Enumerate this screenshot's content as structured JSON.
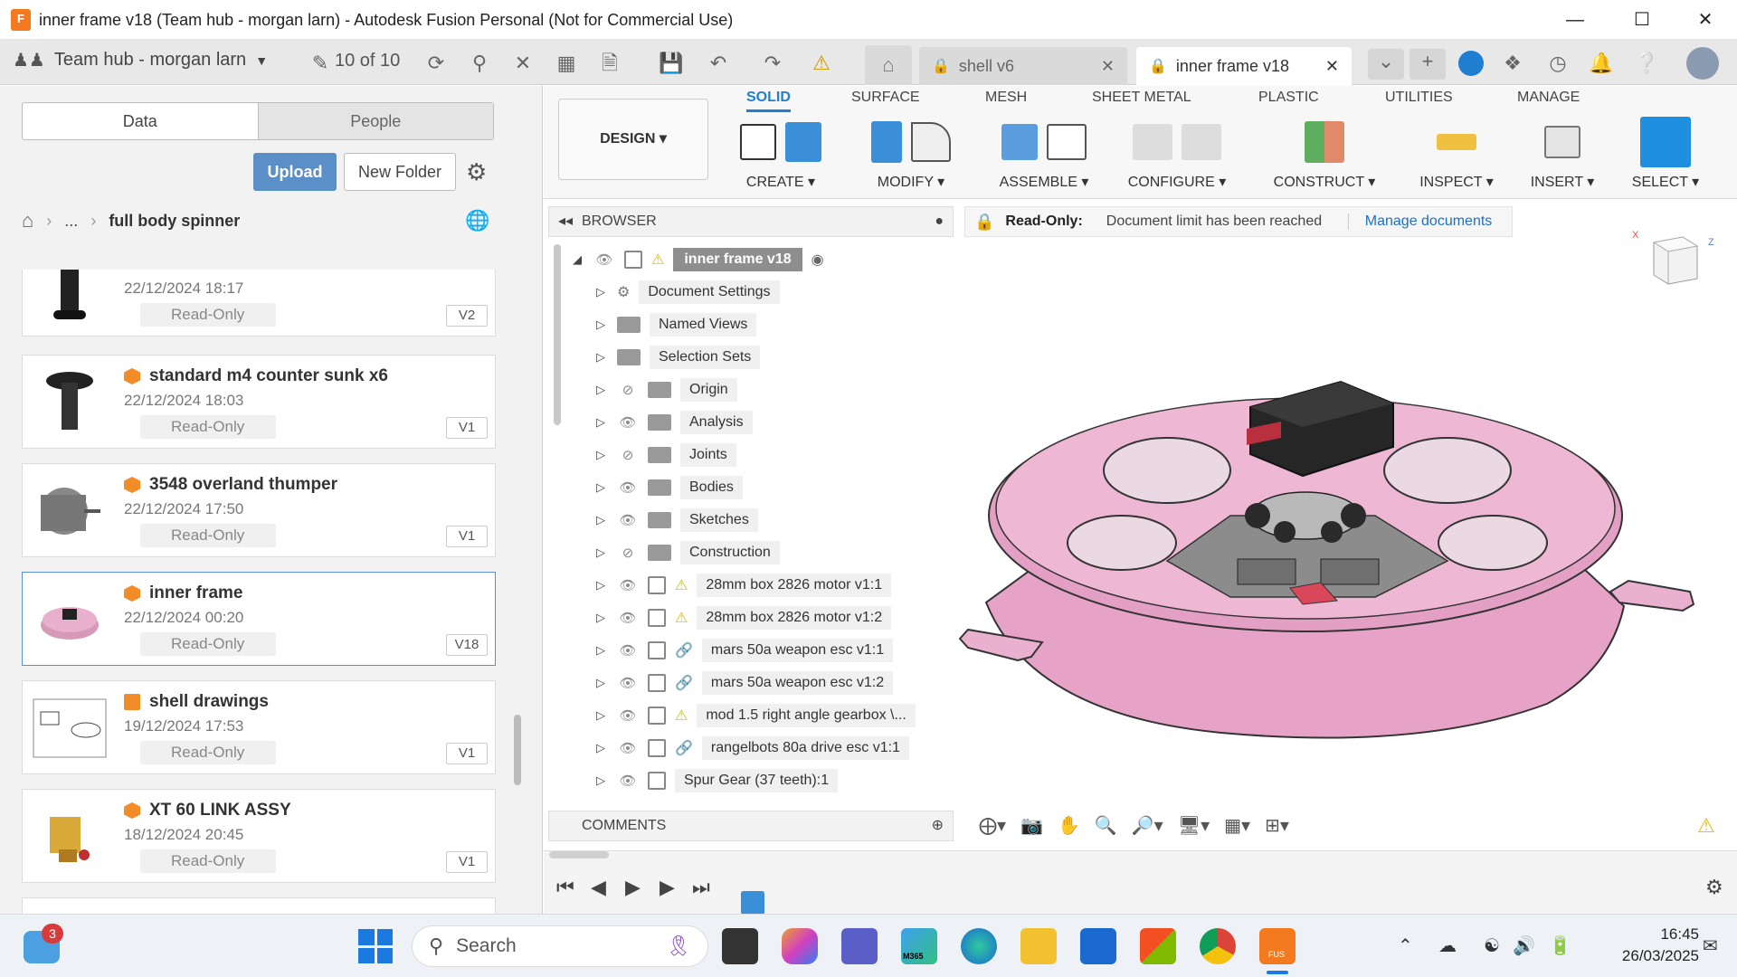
{
  "window": {
    "title": "inner frame v18 (Team hub - morgan larn) - Autodesk Fusion Personal (Not for Commercial Use)",
    "app_icon_text": "F",
    "minimize": "—",
    "maximize": "☐",
    "close": "✕"
  },
  "appbar": {
    "team_hub": "Team hub - morgan larn",
    "doc_count": "10 of 10",
    "tabs": [
      {
        "label": "shell v6"
      },
      {
        "label": "inner frame v18"
      }
    ]
  },
  "data_panel": {
    "segments": [
      "Data",
      "People"
    ],
    "upload_label": "Upload",
    "new_folder_label": "New Folder",
    "breadcrumb": {
      "ellipsis": "...",
      "current": "full body spinner"
    },
    "files": [
      {
        "name": "",
        "date": "22/12/2024 18:17",
        "status": "Read-Only",
        "version": "V2"
      },
      {
        "name": "standard m4 counter sunk x6",
        "date": "22/12/2024 18:03",
        "status": "Read-Only",
        "version": "V1"
      },
      {
        "name": "3548 overland thumper",
        "date": "22/12/2024 17:50",
        "status": "Read-Only",
        "version": "V1"
      },
      {
        "name": "inner frame",
        "date": "22/12/2024 00:20",
        "status": "Read-Only",
        "version": "V18"
      },
      {
        "name": "shell drawings",
        "date": "19/12/2024 17:53",
        "status": "Read-Only",
        "version": "V1"
      },
      {
        "name": "XT 60 LINK ASSY",
        "date": "18/12/2024 20:45",
        "status": "Read-Only",
        "version": "V1"
      }
    ]
  },
  "toolbar": {
    "workspace": "DESIGN",
    "tabs": [
      "SOLID",
      "SURFACE",
      "MESH",
      "SHEET METAL",
      "PLASTIC",
      "UTILITIES",
      "MANAGE"
    ],
    "groups": [
      "CREATE",
      "MODIFY",
      "ASSEMBLE",
      "CONFIGURE",
      "CONSTRUCT",
      "INSPECT",
      "INSERT",
      "SELECT"
    ]
  },
  "browser": {
    "header": "BROWSER",
    "root": "inner frame v18",
    "items": [
      "Document Settings",
      "Named Views",
      "Selection Sets",
      "Origin",
      "Analysis",
      "Joints",
      "Bodies",
      "Sketches",
      "Construction",
      "28mm box 2826 motor v1:1",
      "28mm box 2826 motor v1:2",
      "mars 50a weapon esc v1:1",
      "mars 50a weapon esc v1:2",
      "mod 1.5 right angle gearbox \\...",
      "rangelbots 80a drive esc v1:1",
      "Spur Gear (37 teeth):1"
    ],
    "comments_header": "COMMENTS"
  },
  "banner": {
    "label": "Read-Only:",
    "message": "Document limit has been reached",
    "link": "Manage documents"
  },
  "viewcube": {
    "x": "X",
    "z": "Z"
  },
  "taskbar": {
    "search_label": "Search",
    "notification_count": "3",
    "time": "16:45",
    "date": "26/03/2025",
    "m365_label": "M365",
    "fusion_label": "FUS"
  },
  "colors": {
    "accent": "#1f7ed0",
    "brand": "#f47a20",
    "model": "#e8a0c8",
    "warning": "#e4b800"
  }
}
